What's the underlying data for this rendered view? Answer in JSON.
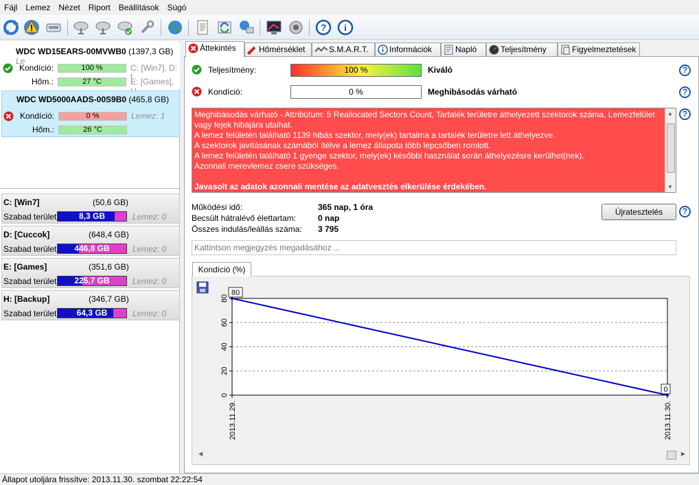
{
  "menu": [
    "Fájl",
    "Lemez",
    "Nézet",
    "Riport",
    "Beállítások",
    "Súgó"
  ],
  "toolbar_icons": [
    "refresh-icon",
    "warning-icon",
    "drive-icon",
    "satellite-dish-icon",
    "satellite-dish-icon",
    "satellite-dish-check-icon",
    "wrench-icon",
    "globe-icon",
    "notepad-icon",
    "sync-icon",
    "network-globe-icon",
    "chart-screen-icon",
    "speaker-icon",
    "help-icon",
    "info-icon"
  ],
  "disks": [
    {
      "name": "WDC WD15EARS-00MVWB0",
      "size": "(1397,3 GB)",
      "extra": "Le",
      "status": "ok",
      "condition_label": "Kondíció:",
      "condition": "100 %",
      "condition_pct": 100,
      "temp_label": "Hőm.:",
      "temp": "27 °C",
      "temp_pct": 100,
      "info1": "C: [Win7], D: [",
      "info2": "E: [Games], H"
    },
    {
      "name": "WDC WD5000AADS-00S9B0",
      "size": "(465,8 GB)",
      "extra": "",
      "status": "fail",
      "condition_label": "Kondíció:",
      "condition": "0 %",
      "condition_pct": 100,
      "temp_label": "Hőm.:",
      "temp": "26 °C",
      "temp_pct": 100,
      "info1": "Lemez: 1",
      "info2": ""
    }
  ],
  "partitions": [
    {
      "name": "C: [Win7]",
      "size": "(50,6 GB)",
      "free_label": "Szabad terület",
      "free": "8,3 GB",
      "free_fraction": 0.83,
      "disk": "Lemez: 0"
    },
    {
      "name": "D: [Cuccok]",
      "size": "(648,4 GB)",
      "free_label": "Szabad terület",
      "free": "446,8 GB",
      "free_fraction": 0.31,
      "disk": "Lemez: 0"
    },
    {
      "name": "E: [Games]",
      "size": "(351,6 GB)",
      "free_label": "Szabad terület",
      "free": "225,7 GB",
      "free_fraction": 0.36,
      "disk": "Lemez: 0"
    },
    {
      "name": "H: [Backup]",
      "size": "(346,7 GB)",
      "free_label": "Szabad terület",
      "free": "64,3 GB",
      "free_fraction": 0.81,
      "disk": "Lemez: 0"
    }
  ],
  "tabs": [
    {
      "label": "Áttekintés",
      "icon": "error-icon"
    },
    {
      "label": "Hőmérséklet",
      "icon": "thermometer-icon"
    },
    {
      "label": "S.M.A.R.T.",
      "icon": "smart-icon"
    },
    {
      "label": "Információk",
      "icon": "info-icon"
    },
    {
      "label": "Napló",
      "icon": "log-icon"
    },
    {
      "label": "Teljesítmény",
      "icon": "gauge-icon"
    },
    {
      "label": "Figyelmeztetések",
      "icon": "alerts-icon"
    }
  ],
  "overview": {
    "performance_label": "Teljesítmény:",
    "performance_value": "100 %",
    "performance_fraction": 1.0,
    "performance_text": "Kiváló",
    "condition_label": "Kondíció:",
    "condition_value": "0 %",
    "condition_text": "Meghibásodás várható",
    "alert_lines": [
      "Meghibásodás várható - Attribútum: 5 Reallocated Sectors Count, Tartalék területre áthelyezett szektorok száma. Lemezfelület vagy fejek hibájára utalhat.",
      "A lemez felületén található 1139 hibás szektor, mely(ek) tartalma a tartalék területre lett áthelyezve.",
      "A szektorok javításának számából ítélve a lemez állapota több lépcsőben romlott.",
      "A lemez felületén található 1 gyenge szektor, mely(ek) későbbi használat során áthelyezésre kerülhet(nek).",
      "Azonnali merevlemez csere szükséges."
    ],
    "alert_bold": "Javasolt az adatok azonnali mentése az adatvesztés elkerülése érdekében.",
    "uptime_label": "Működési idő:",
    "uptime": "365 nap, 1 óra",
    "life_label": "Becsült hátralévő élettartam:",
    "life": "0 nap",
    "starts_label": "Összes indulás/leállás száma:",
    "starts": "3 795",
    "retest_button": "Újratesztelés",
    "comment_placeholder": "Kattintson megjegyzés megadásához ...",
    "chart_tab": "Kondíció  (%)"
  },
  "chart_data": {
    "type": "line",
    "x": [
      "2013.11.29.",
      "2013.11.30."
    ],
    "series": [
      {
        "values": [
          80,
          0
        ]
      }
    ],
    "data_labels": [
      "80",
      "0"
    ],
    "yticks": [
      0,
      20,
      40,
      60,
      80
    ],
    "ylim": [
      0,
      80
    ],
    "xlabel": "",
    "ylabel": "",
    "grid": true,
    "line_color": "#0000cc"
  },
  "statusbar": "Állapot utoljára frissítve: 2013.11.30. szombat 22:22:54"
}
